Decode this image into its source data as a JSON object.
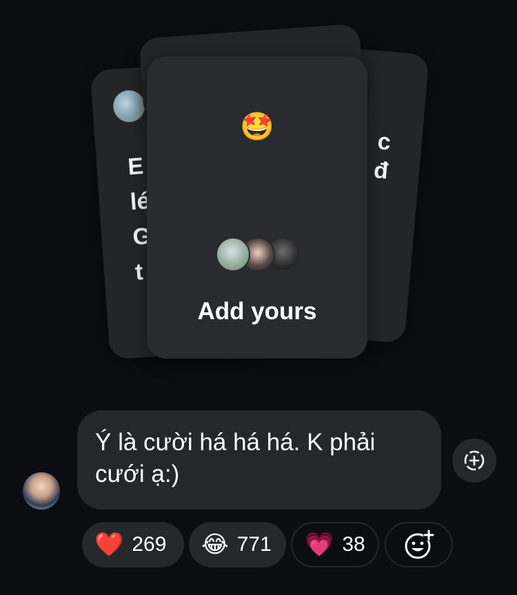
{
  "story_stack": {
    "back_left_text": [
      "E",
      "lé",
      "G",
      "t"
    ],
    "back_right_text": [
      "c",
      "đ"
    ],
    "front_emoji": "🤩",
    "front_label": "Add yours"
  },
  "message": {
    "text": "Ý là cười há há há. K phải cưới ạ:)"
  },
  "reactions": [
    {
      "emoji": "❤️",
      "count": "269"
    },
    {
      "emoji": "😂",
      "count": "771"
    },
    {
      "emoji": "💗",
      "count": "38"
    }
  ],
  "icons": {
    "share": "add-to-story-icon",
    "add_reaction": "add-reaction-icon"
  },
  "colors": {
    "background": "#0b0d12",
    "bubble": "#26272b",
    "card": "#2a2b2f"
  }
}
